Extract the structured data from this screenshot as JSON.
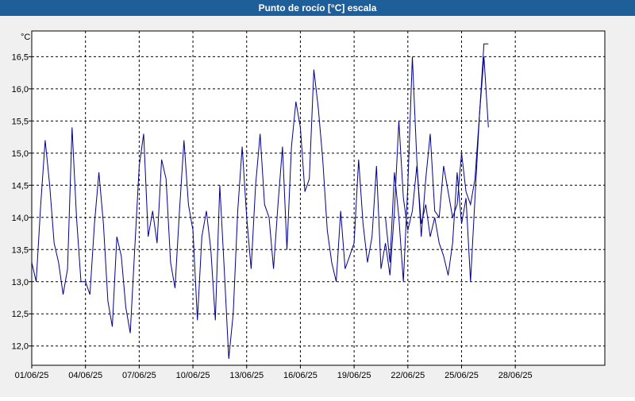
{
  "window": {
    "title": "Punto de rocío [°C] escala"
  },
  "chart_data": {
    "type": "line",
    "title": "Punto de rocío [°C] escala",
    "ylabel": "°C",
    "xlabel": "",
    "xlim": [
      "01/06/25",
      "03/07/25"
    ],
    "ylim": [
      11.7,
      16.9
    ],
    "grid": true,
    "legend": "none",
    "line_color": "#00008b",
    "x_ticks": [
      "01/06/25",
      "04/06/25",
      "07/06/25",
      "10/06/25",
      "13/06/25",
      "16/06/25",
      "19/06/25",
      "22/06/25",
      "25/06/25",
      "28/06/25"
    ],
    "y_ticks": [
      "12,0",
      "12,5",
      "13,0",
      "13,5",
      "14,0",
      "14,5",
      "15,0",
      "15,5",
      "16,0",
      "16,5"
    ],
    "y_tick_values": [
      12.0,
      12.5,
      13.0,
      13.5,
      14.0,
      14.5,
      15.0,
      15.5,
      16.0,
      16.5
    ],
    "series": [
      {
        "x": [
          "01/06/25 00:00",
          "01/06/25 06:00",
          "01/06/25 12:00",
          "01/06/25 18:00",
          "02/06/25 00:00",
          "02/06/25 06:00",
          "02/06/25 12:00",
          "02/06/25 18:00",
          "03/06/25 00:00",
          "03/06/25 06:00",
          "03/06/25 12:00",
          "03/06/25 18:00",
          "04/06/25 00:00",
          "04/06/25 06:00",
          "04/06/25 12:00",
          "04/06/25 18:00",
          "05/06/25 00:00",
          "05/06/25 06:00",
          "05/06/25 12:00",
          "05/06/25 18:00",
          "06/06/25 00:00",
          "06/06/25 06:00",
          "06/06/25 12:00",
          "06/06/25 18:00",
          "07/06/25 00:00",
          "07/06/25 06:00",
          "07/06/25 12:00",
          "07/06/25 18:00",
          "08/06/25 00:00",
          "08/06/25 06:00",
          "08/06/25 12:00",
          "08/06/25 18:00",
          "09/06/25 00:00",
          "09/06/25 06:00",
          "09/06/25 12:00",
          "09/06/25 18:00",
          "10/06/25 00:00",
          "10/06/25 06:00",
          "10/06/25 12:00",
          "10/06/25 18:00",
          "11/06/25 00:00",
          "11/06/25 06:00",
          "11/06/25 12:00",
          "11/06/25 18:00",
          "12/06/25 00:00",
          "12/06/25 06:00",
          "12/06/25 12:00",
          "12/06/25 18:00",
          "13/06/25 00:00",
          "13/06/25 06:00",
          "13/06/25 12:00",
          "13/06/25 18:00",
          "14/06/25 00:00",
          "14/06/25 06:00",
          "14/06/25 12:00",
          "14/06/25 18:00",
          "15/06/25 00:00",
          "15/06/25 06:00",
          "15/06/25 12:00",
          "15/06/25 18:00",
          "16/06/25 00:00",
          "16/06/25 06:00",
          "16/06/25 12:00",
          "16/06/25 18:00",
          "17/06/25 00:00",
          "17/06/25 06:00",
          "17/06/25 12:00",
          "17/06/25 18:00",
          "18/06/25 00:00",
          "18/06/25 06:00",
          "18/06/25 12:00",
          "18/06/25 18:00",
          "19/06/25 00:00",
          "19/06/25 06:00",
          "19/06/25 12:00",
          "19/06/25 18:00",
          "20/06/25 00:00",
          "20/06/25 06:00",
          "20/06/25 12:00",
          "20/06/25 18:00",
          "21/06/25 00:00",
          "21/06/25 06:00",
          "21/06/25 12:00",
          "21/06/25 18:00",
          "22/06/25 00:00",
          "22/06/25 06:00",
          "22/06/25 12:00",
          "22/06/25 18:00",
          "23/06/25 00:00",
          "23/06/25 06:00",
          "23/06/25 12:00",
          "23/06/25 18:00",
          "24/06/25 00:00",
          "24/06/25 06:00",
          "24/06/25 12:00",
          "24/06/25 18:00",
          "25/06/25 00:00",
          "25/06/25 06:00",
          "25/06/25 12:00",
          "25/06/25 18:00",
          "26/06/25 00:00",
          "26/06/25 06:00",
          "26/06/25 12:00"
        ],
        "values": [
          13.3,
          13.0,
          14.2,
          15.2,
          14.5,
          13.6,
          13.3,
          12.8,
          13.2,
          15.4,
          14.0,
          13.0,
          13.0,
          12.8,
          13.9,
          14.7,
          13.9,
          12.7,
          12.3,
          13.7,
          13.4,
          12.6,
          12.2,
          13.5,
          14.8,
          15.3,
          13.7,
          14.1,
          13.6,
          14.9,
          14.6,
          13.3,
          12.9,
          14.1,
          15.2,
          14.2,
          13.8,
          12.4,
          13.7,
          14.1,
          13.5,
          12.4,
          14.5,
          13.2,
          11.8,
          12.5,
          14.1,
          15.1,
          14.0,
          13.2,
          14.5,
          15.3,
          14.2,
          14.0,
          13.2,
          14.2,
          15.1,
          13.5,
          15.1,
          15.8,
          15.4,
          14.4,
          14.6,
          16.3,
          15.7,
          14.9,
          13.8,
          13.3,
          13.0,
          14.1,
          13.2,
          13.4,
          13.6,
          14.9,
          13.9,
          13.3,
          13.7,
          14.8,
          13.2,
          13.6,
          13.1,
          14.1,
          15.5,
          14.3,
          13.8,
          14.1,
          14.8,
          13.9,
          14.2,
          13.7,
          14.0,
          13.6,
          13.4,
          13.1,
          13.6,
          14.7,
          13.9,
          14.3,
          13.0,
          14.3,
          15.6,
          16.5,
          15.4
        ]
      },
      {
        "x": [
          "20/06/25 18:00",
          "21/06/25 00:00",
          "21/06/25 06:00",
          "21/06/25 12:00",
          "21/06/25 18:00",
          "22/06/25 00:00",
          "22/06/25 06:00",
          "22/06/25 12:00",
          "22/06/25 18:00",
          "23/06/25 00:00",
          "23/06/25 06:00",
          "23/06/25 12:00",
          "23/06/25 18:00",
          "24/06/25 00:00",
          "24/06/25 06:00",
          "24/06/25 12:00",
          "24/06/25 18:00",
          "25/06/25 00:00",
          "25/06/25 06:00",
          "25/06/25 12:00",
          "25/06/25 18:00",
          "26/06/25 00:00",
          "26/06/25 06:00",
          "26/06/25 12:00"
        ],
        "values": [
          14.0,
          13.3,
          14.7,
          14.0,
          13.0,
          14.5,
          16.5,
          14.9,
          13.7,
          14.6,
          15.3,
          14.1,
          14.0,
          14.8,
          14.4,
          14.0,
          14.2,
          15.0,
          14.4,
          14.2,
          14.6,
          15.6,
          16.7,
          16.7
        ]
      }
    ]
  }
}
